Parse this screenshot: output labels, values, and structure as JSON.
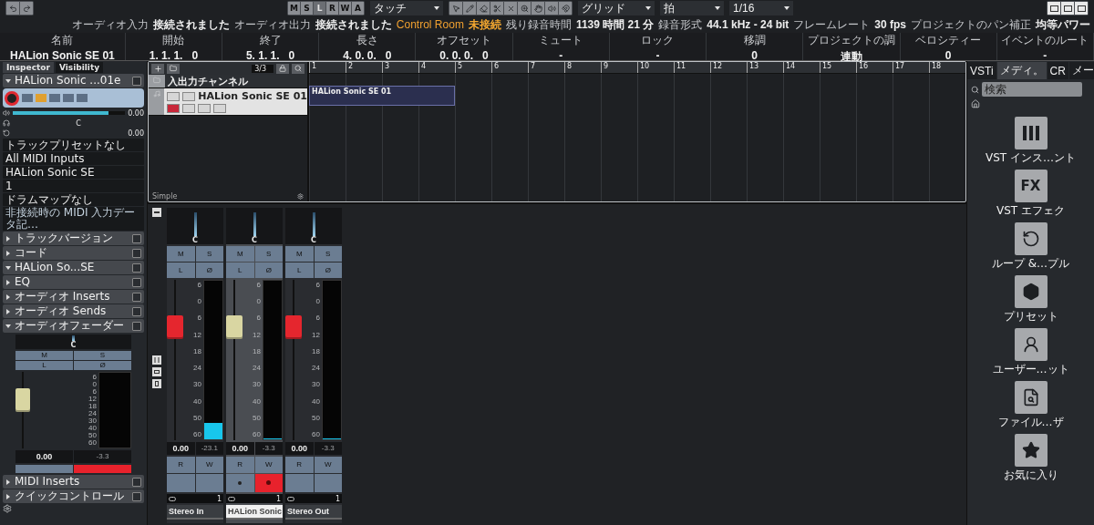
{
  "toolbar": {
    "automation": [
      {
        "label": "M",
        "disabled": false
      },
      {
        "label": "S",
        "disabled": false
      },
      {
        "label": "L",
        "disabled": true
      },
      {
        "label": "R",
        "disabled": false
      },
      {
        "label": "W",
        "disabled": false
      },
      {
        "label": "A",
        "disabled": false
      }
    ],
    "automation_mode": "タッチ",
    "snap_type": "グリッド",
    "grid": "拍",
    "quantize": "1/16"
  },
  "status_bar": [
    {
      "label": "オーディオ入力",
      "value": "接続されました",
      "warning": false
    },
    {
      "label": "オーディオ出力",
      "value": "接続されました",
      "warning": false
    },
    {
      "label": "Control Room",
      "value": "未接続",
      "warning": true
    },
    {
      "label": "残り録音時間",
      "value": "1139 時間 21 分",
      "warning": false
    },
    {
      "label": "録音形式",
      "value": "44.1 kHz - 24 bit",
      "warning": false
    },
    {
      "label": "フレームレート",
      "value": "30 fps",
      "warning": false
    },
    {
      "label": "プロジェクトのパン補正",
      "value": "均等パワー",
      "warning": false
    }
  ],
  "info_line": [
    {
      "label": "名前",
      "value": "HALion Sonic SE 01"
    },
    {
      "label": "開始",
      "value": "1. 1. 1.   0"
    },
    {
      "label": "終了",
      "value": "5. 1. 1.   0"
    },
    {
      "label": "長さ",
      "value": "4. 0. 0.   0"
    },
    {
      "label": "オフセット",
      "value": "0. 0. 0.   0"
    },
    {
      "label": "ミュート",
      "value": "-"
    },
    {
      "label": "ロック",
      "value": "-"
    },
    {
      "label": "移調",
      "value": "0"
    },
    {
      "label": "プロジェクトの調",
      "value": "連動"
    },
    {
      "label": "ベロシティー",
      "value": "0"
    },
    {
      "label": "イベントのルート",
      "value": "-"
    }
  ],
  "inspector": {
    "tabs": [
      {
        "label": "Inspector",
        "selected": true
      },
      {
        "label": "Visibility",
        "selected": false
      }
    ],
    "track_name": "HALion Sonic ...01e",
    "volume": {
      "value": "0.00",
      "level": 0.85
    },
    "pan": "C",
    "delay": "0.00",
    "preset": "トラックプリセットなし",
    "midi_input": "All MIDI Inputs",
    "midi_output": "HALion Sonic SE",
    "channel": "1",
    "drum_map": "ドラムマップなし",
    "midi_input_note": "非接続時の MIDI 入力データ記…",
    "sections": [
      {
        "label": "トラックバージョン",
        "expanded": false
      },
      {
        "label": "コード",
        "expanded": false
      },
      {
        "label": "HALion So...SE",
        "expanded": true
      },
      {
        "label": "EQ",
        "expanded": false
      },
      {
        "label": "オーディオ Inserts",
        "expanded": false
      },
      {
        "label": "オーディオ Sends",
        "expanded": false
      },
      {
        "label": "オーディオフェーダー",
        "expanded": true,
        "fader": {
          "pan": "C",
          "buttons": [
            "M",
            "S",
            "L",
            "Ø"
          ],
          "scale": [
            "6",
            "0",
            "6",
            "12",
            "18",
            "24",
            "30",
            "40",
            "50",
            "60"
          ],
          "volume": "0.00",
          "peak": "-3.3",
          "record": true
        }
      },
      {
        "label": "MIDI Inserts",
        "expanded": false
      },
      {
        "label": "クイックコントロール",
        "expanded": false
      }
    ]
  },
  "project": {
    "track_count": "3/3",
    "tracks": [
      {
        "name": "入出力チャンネル",
        "kind": "folder",
        "selected": false
      },
      {
        "name": "HALion Sonic SE 01",
        "kind": "instrument",
        "selected": true
      }
    ],
    "footer": "Simple",
    "ruler": [
      "1",
      "2",
      "3",
      "4",
      "5",
      "6",
      "7",
      "8",
      "9",
      "10",
      "11",
      "12",
      "13",
      "14",
      "15",
      "16",
      "17",
      "18"
    ],
    "events": [
      {
        "name": "HALion Sonic SE 01"
      }
    ]
  },
  "mixer": {
    "channels": [
      {
        "name": "Stereo In",
        "selected": false,
        "pan": "C",
        "buttons": [
          "M",
          "S",
          "L",
          "Ø"
        ],
        "scale": [
          "6",
          "0",
          "6",
          "12",
          "18",
          "24",
          "30",
          "40",
          "50",
          "60"
        ],
        "color": "#e5262e",
        "level": 0.1,
        "volume": "0.00",
        "peak": "-23.1",
        "lower_buttons": [
          "R",
          "W"
        ],
        "monitor": false,
        "record": false,
        "routing": "1"
      },
      {
        "name": "HALion Sonic",
        "selected": true,
        "pan": "C",
        "buttons": [
          "M",
          "S",
          "L",
          "Ø"
        ],
        "scale": [
          "6",
          "0",
          "6",
          "12",
          "18",
          "24",
          "30",
          "40",
          "50",
          "60"
        ],
        "color": "#d9d6a2",
        "level": 0,
        "volume": "0.00",
        "peak": "-3.3",
        "lower_buttons": [
          "R",
          "W"
        ],
        "monitor": true,
        "record": true,
        "routing": "1"
      },
      {
        "name": "Stereo Out",
        "selected": false,
        "pan": "C",
        "buttons": [
          "M",
          "S",
          "L",
          "Ø"
        ],
        "scale": [
          "6",
          "0",
          "6",
          "12",
          "18",
          "24",
          "30",
          "40",
          "50",
          "60"
        ],
        "color": "#e5262e",
        "level": 0,
        "volume": "0.00",
        "peak": "-3.3",
        "lower_buttons": [
          "R",
          "W"
        ],
        "monitor": false,
        "record": false,
        "routing": "1"
      }
    ]
  },
  "media": {
    "tabs": [
      {
        "label": "VSTi",
        "selected": false
      },
      {
        "label": "メディ。",
        "selected": true
      },
      {
        "label": "CR",
        "selected": false
      },
      {
        "label": "メー",
        "selected": false
      }
    ],
    "search": {
      "placeholder": "検索"
    },
    "tiles": [
      {
        "label": "VST インス…ント",
        "kind": "piano"
      },
      {
        "label": "VST エフェク",
        "kind": "text",
        "glyph": "FX"
      },
      {
        "label": "ループ &…プル",
        "kind": "loop"
      },
      {
        "label": "プリセット",
        "kind": "preset"
      },
      {
        "label": "ユーザー…ット",
        "kind": "user"
      },
      {
        "label": "ファイル…ザ",
        "kind": "file"
      },
      {
        "label": "お気に入り",
        "kind": "star"
      }
    ]
  }
}
